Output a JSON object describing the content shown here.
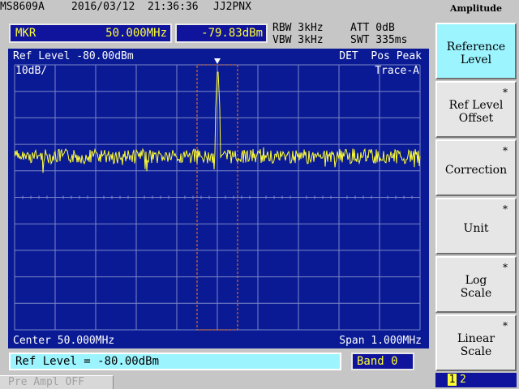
{
  "header": {
    "model": "MS8609A",
    "date": "2016/03/12",
    "time": "21:36:36",
    "callsign": "JJ2PNX"
  },
  "marker": {
    "label": "MKR",
    "frequency": "50.000MHz",
    "level": "-79.83dBm"
  },
  "params": {
    "rbw": "RBW 3kHz",
    "vbw": "VBW 3kHz",
    "att": "ATT 0dB",
    "swt": "SWT 335ms"
  },
  "screen": {
    "ref_level": "Ref Level -80.00dBm",
    "scale": "10dB/",
    "detector": "DET  Pos Peak",
    "trace": "Trace-A",
    "center": "Center 50.000MHz",
    "span": "Span 1.000MHz"
  },
  "entry": {
    "text": "Ref Level = -80.00dBm",
    "band": "Band 0"
  },
  "status": {
    "preamp": "Pre Ampl OFF"
  },
  "menu": {
    "title": "Amplitude",
    "keys": [
      {
        "label": "Reference\nLevel",
        "star": "",
        "active": true
      },
      {
        "label": "Ref Level\nOffset",
        "star": "*",
        "active": false
      },
      {
        "label": "Correction",
        "star": "*",
        "active": false
      },
      {
        "label": "Unit",
        "star": "*",
        "active": false
      },
      {
        "label": "Log\nScale",
        "star": "*",
        "active": false
      },
      {
        "label": "Linear\nScale",
        "star": "*",
        "active": false
      }
    ],
    "page_current": "1",
    "page_other": "2"
  },
  "colors": {
    "screen_bg": "#0a1a94",
    "trace": "#ffff33",
    "grid": "#7a86c8",
    "marker_window": "#ff7a1a"
  }
}
